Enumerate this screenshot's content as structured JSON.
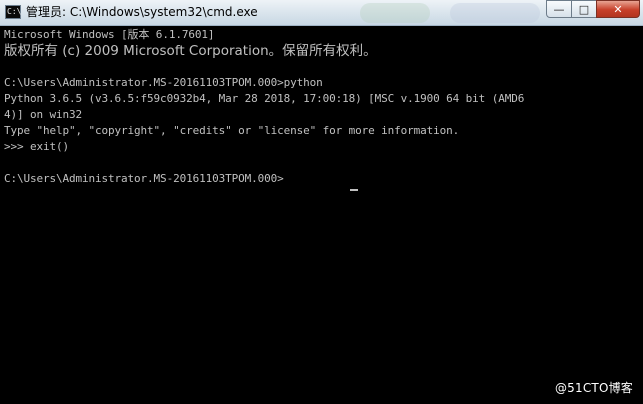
{
  "window": {
    "title": "管理员: C:\\Windows\\system32\\cmd.exe",
    "icon": "cmd-icon",
    "icon_glyph": "C:\\"
  },
  "controls": {
    "minimize": "—",
    "maximize": "□",
    "close": "✕"
  },
  "console": {
    "lines": [
      "Microsoft Windows [版本 6.1.7601]",
      "版权所有 (c) 2009 Microsoft Corporation。保留所有权利。",
      "",
      "C:\\Users\\Administrator.MS-20161103TPOM.000>python",
      "Python 3.6.5 (v3.6.5:f59c0932b4, Mar 28 2018, 17:00:18) [MSC v.1900 64 bit (AMD6",
      "4)] on win32",
      "Type \"help\", \"copyright\", \"credits\" or \"license\" for more information.",
      ">>> exit()",
      "",
      "C:\\Users\\Administrator.MS-20161103TPOM.000>"
    ]
  },
  "watermark": "@51CTO博客"
}
